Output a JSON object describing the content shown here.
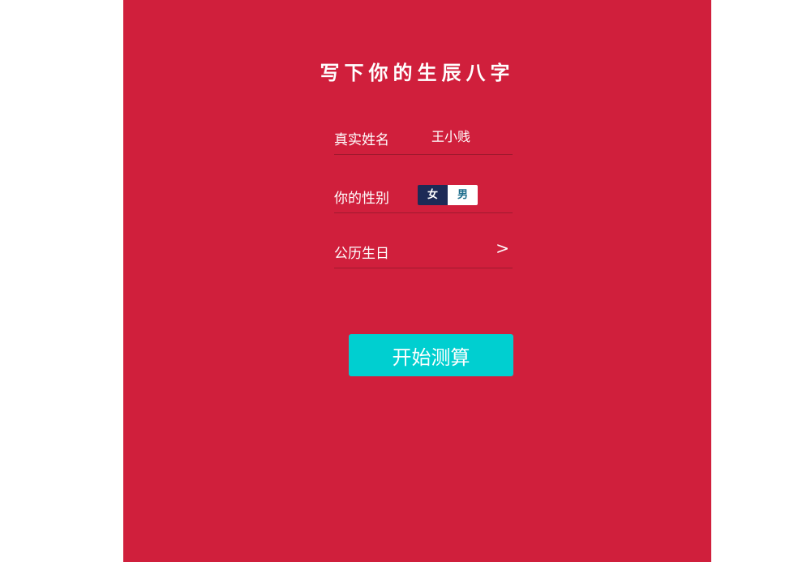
{
  "form": {
    "title": "写下你的生辰八字",
    "name_label": "真实姓名",
    "name_value": "王小贱",
    "gender_label": "你的性别",
    "gender_options": [
      "女",
      "男"
    ],
    "gender_selected": "女",
    "birth_label": "公历生日",
    "birth_arrow": ">",
    "submit_label": "开始测算"
  },
  "colors": {
    "panel_bg": "#d01f3c",
    "button_bg": "#00cfd0",
    "toggle_selected": "#1d2a56",
    "toggle_unselected_text": "#1d6d8c"
  }
}
